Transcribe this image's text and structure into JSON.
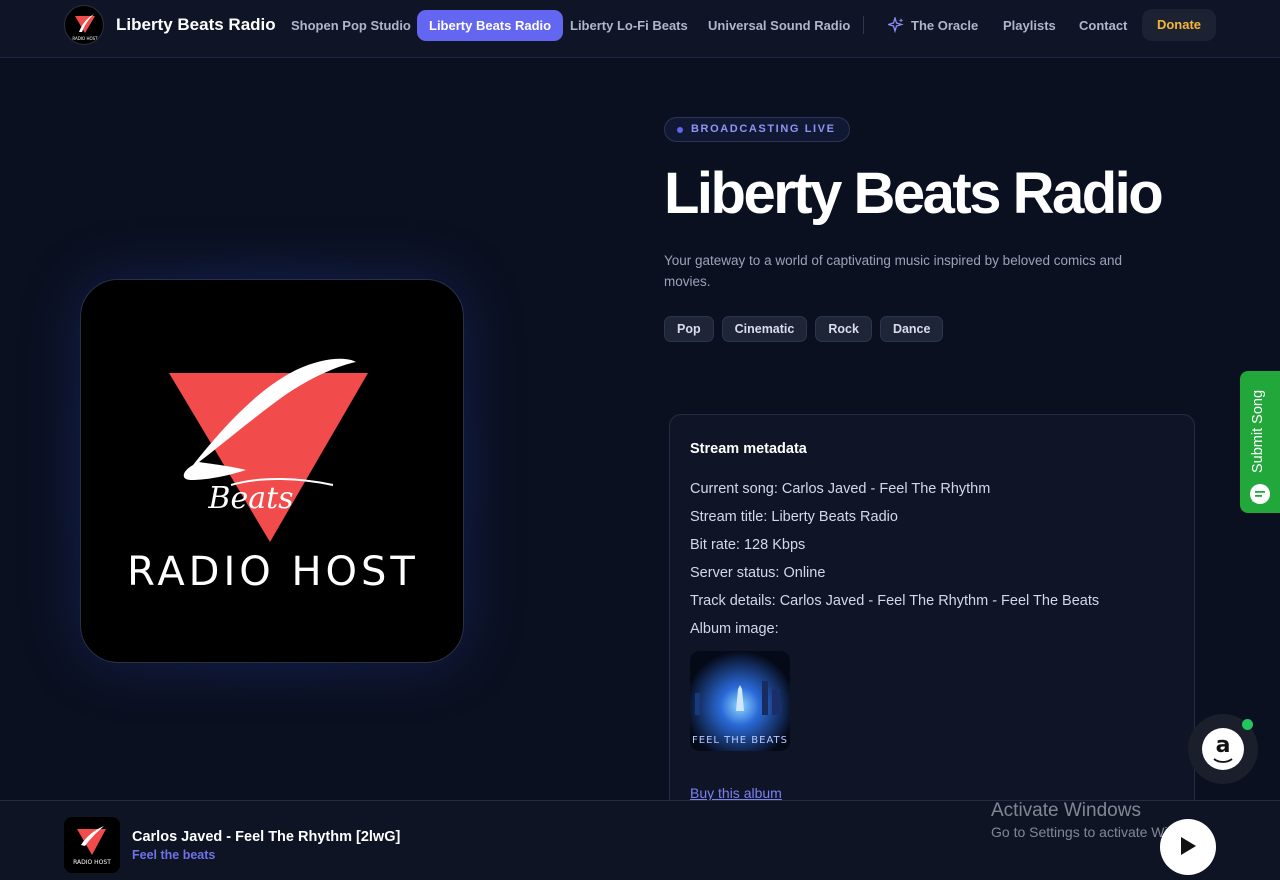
{
  "nav": {
    "brand": "Liberty Beats Radio",
    "links": [
      {
        "label": "Shopen Pop Studio"
      },
      {
        "label": "Liberty Beats Radio"
      },
      {
        "label": "Liberty Lo-Fi Beats"
      },
      {
        "label": "Universal Sound Radio"
      },
      {
        "label": "The Oracle"
      },
      {
        "label": "Playlists"
      },
      {
        "label": "Contact"
      }
    ],
    "donate_label": "Donate"
  },
  "hero": {
    "badge": "BROADCASTING LIVE",
    "title": "Liberty Beats Radio",
    "description": "Your gateway to a world of captivating music inspired by beloved comics and movies.",
    "tags": [
      "Pop",
      "Cinematic",
      "Rock",
      "Dance"
    ],
    "logo_text": "RADIO HOST",
    "logo_script": "Beats"
  },
  "metadata": {
    "heading": "Stream metadata",
    "rows": [
      "Current song: Carlos Javed - Feel The Rhythm",
      "Stream title: Liberty Beats Radio",
      "Bit rate: 128 Kbps",
      "Server status: Online",
      "Track details: Carlos Javed - Feel The Rhythm - Feel The Beats",
      "Album image:"
    ],
    "album_thumb_text": "FEEL THE BEATS",
    "buy_label": "Buy this album"
  },
  "submit_song": {
    "label": "Submit Song"
  },
  "amazon": {
    "letter": "a"
  },
  "player": {
    "title": "Carlos Javed - Feel The Rhythm [2lwG]",
    "subtitle": "Feel the beats",
    "logo_text": "RADIO HOST"
  },
  "watermark": {
    "line1": "Activate Windows",
    "line2": "Go to Settings to activate Windows."
  },
  "colors": {
    "accent": "#6366f1",
    "logo_red": "#f24b4b",
    "donate": "#f5b73b",
    "submit_green": "#22a83a"
  },
  "icons": {
    "oracle": "sparkle-icon",
    "submit": "chat-bubble-icon",
    "play": "play-icon",
    "amazon": "amazon-logo-icon"
  }
}
